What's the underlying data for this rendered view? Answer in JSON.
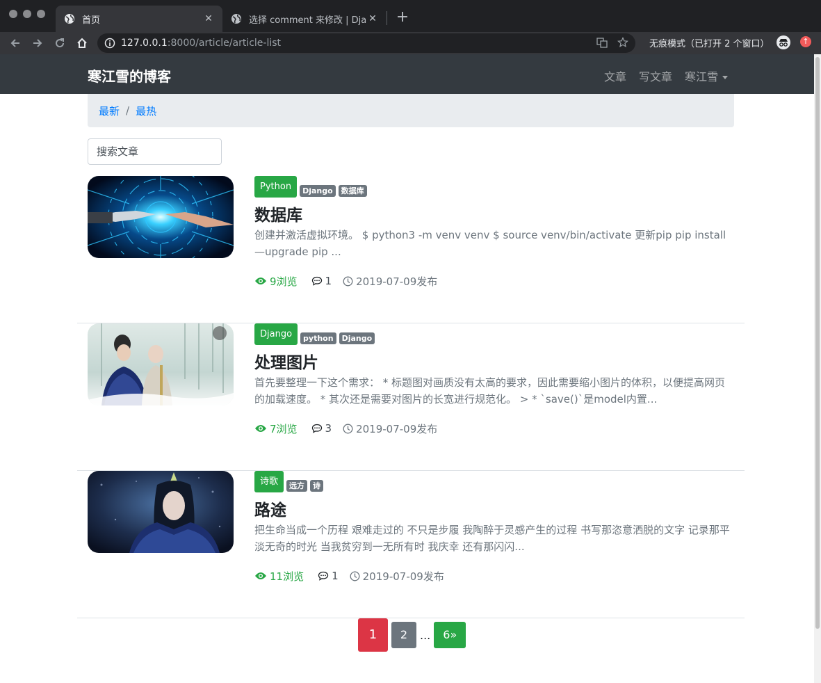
{
  "browser": {
    "tabs": [
      {
        "title": "首页",
        "active": true
      },
      {
        "title": "选择 comment 来修改 | Django",
        "active": false
      }
    ],
    "url": {
      "host": "127.0.0.1",
      "path": ":8000/article/article-list"
    },
    "incognito_text": "无痕模式（已打开 2 个窗口）"
  },
  "site": {
    "brand": "寒江雪的博客",
    "nav": [
      {
        "label": "文章"
      },
      {
        "label": "写文章"
      },
      {
        "label": "寒江雪",
        "dropdown": true
      }
    ],
    "breadcrumb": [
      {
        "label": "最新"
      },
      {
        "label": "最热"
      }
    ],
    "search": {
      "placeholder": "搜索文章"
    }
  },
  "articles": [
    {
      "column": "Python",
      "tags": [
        "Django",
        "数据库"
      ],
      "title": "数据库",
      "body": "创建并激活虚拟环境。 $ python3 -m venv venv $ source venv/bin/activate 更新pip pip install —upgrade pip ...",
      "views": "9浏览",
      "comments": "1",
      "date": "2019-07-09发布"
    },
    {
      "column": "Django",
      "tags": [
        "python",
        "Django"
      ],
      "title": "处理图片",
      "body": "首先要整理一下这个需求： * 标题图对画质没有太高的要求，因此需要缩小图片的体积，以便提高网页的加载速度。 * 其次还是需要对图片的长宽进行规范化。 > * `save()`是model内置...",
      "views": "7浏览",
      "comments": "3",
      "date": "2019-07-09发布"
    },
    {
      "column": "诗歌",
      "tags": [
        "远方",
        "诗"
      ],
      "title": "路途",
      "body": "把生命当成一个历程 艰难走过的 不只是步履 我陶醉于灵感产生的过程 书写那恣意洒脱的文字 记录那平淡无奇的时光 当我贫穷到一无所有时 我庆幸 还有那闪闪...",
      "views": "11浏览",
      "comments": "1",
      "date": "2019-07-09发布"
    }
  ],
  "pagination": {
    "current": "1",
    "next": "2",
    "ellipsis": "...",
    "last": "6»"
  },
  "colors": {
    "navbar": "#343a40",
    "success": "#28a745",
    "danger": "#dc3545",
    "secondary": "#6c757d",
    "link": "#007bff"
  }
}
